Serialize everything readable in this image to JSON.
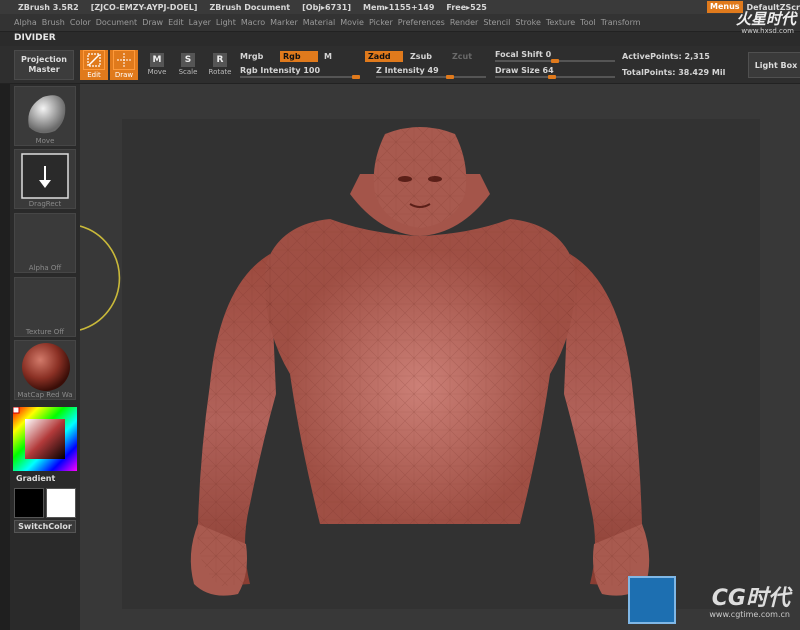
{
  "title_bar": {
    "app": "ZBrush 3.5R2",
    "code": "[ZJCO-EMZY-AYPJ-DOEL]",
    "document": "ZBrush Document",
    "obj": "[Obj▸6731]",
    "mem": "Mem▸1155+149",
    "free": "Free▸525",
    "menus_label": "Menus",
    "default_script": "DefaultZScr"
  },
  "menu_bar": {
    "items": [
      "Alpha",
      "Brush",
      "Color",
      "Document",
      "Draw",
      "Edit",
      "Layer",
      "Light",
      "Macro",
      "Marker",
      "Material",
      "Movie",
      "Picker",
      "Preferences",
      "Render",
      "Stencil",
      "Stroke",
      "Texture",
      "Tool",
      "Transform"
    ]
  },
  "divider_label": "DIVIDER",
  "toolbar": {
    "projection_master_line1": "Projection",
    "projection_master_line2": "Master",
    "edit": "Edit",
    "draw": "Draw",
    "move": "Move",
    "scale": "Scale",
    "rotate": "Rotate",
    "move_key": "M",
    "scale_key": "S",
    "rotate_key": "R",
    "mrgb": "Mrgb",
    "rgb": "Rgb",
    "m": "M",
    "zadd": "Zadd",
    "zsub": "Zsub",
    "zcut": "Zcut",
    "rgb_intensity": "Rgb Intensity 100",
    "z_intensity": "Z Intensity 49",
    "focal_shift": "Focal Shift 0",
    "draw_size": "Draw Size 64",
    "active_points": "ActivePoints: 2,315",
    "total_points": "TotalPoints: 38.429 Mil",
    "light_box": "Light Box"
  },
  "left_tray": {
    "brush_label": "Move",
    "stroke_label": "DragRect",
    "alpha_label": "Alpha Off",
    "texture_label": "Texture Off",
    "material_label": "MatCap Red Wa",
    "gradient_label": "Gradient",
    "switch_color": "SwitchColor"
  },
  "watermarks": {
    "top_brand": "火星时代",
    "top_url": "www.hxsd.com",
    "bottom_brand": "CG时代",
    "bottom_url": "www.cgtime.com.cn"
  },
  "colors": {
    "accent": "#e07a1c",
    "skin": "#a8574a",
    "background": "#383838"
  }
}
